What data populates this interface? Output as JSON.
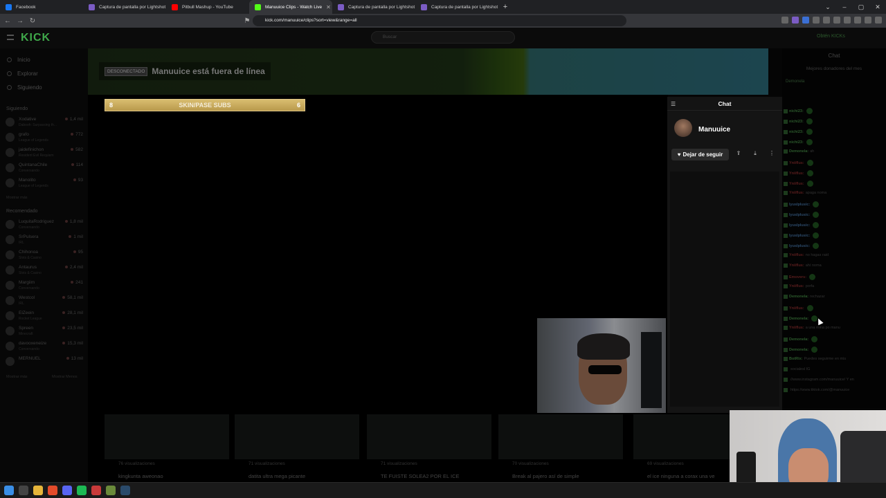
{
  "browser": {
    "tabs": [
      {
        "label": "Facebook",
        "color": "#1877f2"
      },
      {
        "label": "Captura de pantalla por Lightshot",
        "color": "#7b5cc4"
      },
      {
        "label": "Pitbull Mashup - YouTube",
        "color": "#ff0000"
      },
      {
        "label": "Manuuice Clips - Watch Live",
        "color": "#53fc18",
        "active": true
      },
      {
        "label": "Captura de pantalla por Lightshot",
        "color": "#7b5cc4"
      },
      {
        "label": "Captura de pantalla por Lightshot",
        "color": "#7b5cc4"
      }
    ],
    "url": "kick.com/manuuice/clips?sort=view&range=all"
  },
  "kick": {
    "logo": "KICK",
    "search_placeholder": "Buscar",
    "get_kicks": "Obtén KICKs"
  },
  "sidebar": {
    "nav": [
      {
        "label": "Inicio",
        "icon": "home-icon"
      },
      {
        "label": "Explorar",
        "icon": "compass-icon"
      },
      {
        "label": "Siguiendo",
        "icon": "heart-icon"
      }
    ],
    "following_title": "Siguiendo",
    "following": [
      {
        "name": "Xodative",
        "category": "Dabooh: Surpassing th...",
        "count": "1,4 mil"
      },
      {
        "name": "grafo",
        "category": "League of Legends",
        "count": "772"
      },
      {
        "name": "jaidefinichon",
        "category": "Resident Evil Requiem",
        "count": "582"
      },
      {
        "name": "QuintanaChile",
        "category": "Conversando",
        "count": "114"
      },
      {
        "name": "Manolito",
        "category": "League of Legends",
        "count": "93"
      }
    ],
    "following_more": "Mostrar más",
    "recommended_title": "Recomendado",
    "recommended": [
      {
        "name": "LuquitaRodriguez",
        "category": "Conversando",
        "count": "1,8 mil"
      },
      {
        "name": "SrPulsera",
        "category": "IRL",
        "count": "1 mil"
      },
      {
        "name": "Chihonoa",
        "category": "Slots & Casino",
        "count": "95"
      },
      {
        "name": "Antaurus",
        "category": "Slots & Casino",
        "count": "2,4 mil"
      },
      {
        "name": "Margiim",
        "category": "Conversando",
        "count": "241"
      },
      {
        "name": "Westcol",
        "category": "IRL",
        "count": "58,1 mil"
      },
      {
        "name": "ElZeein",
        "category": "Rocket League",
        "count": "28,1 mil"
      },
      {
        "name": "Spreen",
        "category": "Minecraft",
        "count": "23,5 mil"
      },
      {
        "name": "davooxeneize",
        "category": "Conversando",
        "count": "15,3 mil"
      },
      {
        "name": "MERNUEL",
        "category": "",
        "count": "13 mil"
      }
    ],
    "recommended_more": "Mostrar más",
    "recommended_less": "Mostrar Menos"
  },
  "banner": {
    "offline_badge": "DESCONECTADO",
    "offline_text": "Manuuice está fuera de línea"
  },
  "goal": {
    "left": "8",
    "label": "SKIN/PASE SUBS",
    "right": "6"
  },
  "chat_popup": {
    "title": "Chat",
    "streamer": "Manuuice",
    "follow_label": "Dejar de seguir"
  },
  "right_chat": {
    "title": "Chat",
    "top_donors": "Mejores donadores del mes",
    "donor": "Demonela",
    "lines": [
      {
        "user": "nichi23:",
        "msg": "",
        "color": "#2c5a2c"
      },
      {
        "user": "nichi23:",
        "msg": "",
        "color": "#2c5a2c"
      },
      {
        "user": "nichi23:",
        "msg": "",
        "color": "#2c5a2c"
      },
      {
        "user": "nichi23:",
        "msg": "",
        "color": "#2c5a2c"
      },
      {
        "user": "Demonela:",
        "msg": "ah",
        "color": "#2c5a2c"
      },
      {
        "user": "Yniiflus:",
        "msg": "",
        "color": "#5a1d1d"
      },
      {
        "user": "Yniiflus:",
        "msg": "",
        "color": "#5a1d1d"
      },
      {
        "user": "Yniiflus:",
        "msg": "",
        "color": "#5a1d1d"
      },
      {
        "user": "Yniiflus:",
        "msg": "apaga noma",
        "color": "#5a1d1d"
      },
      {
        "user": "lyuslplusic:",
        "msg": "",
        "color": "#2c4a6a"
      },
      {
        "user": "lyuslplusic:",
        "msg": "",
        "color": "#2c4a6a"
      },
      {
        "user": "lyuslplusic:",
        "msg": "",
        "color": "#2c4a6a"
      },
      {
        "user": "lyuslplusic:",
        "msg": "",
        "color": "#2c4a6a"
      },
      {
        "user": "lyuslplusic:",
        "msg": "",
        "color": "#2c4a6a"
      },
      {
        "user": "Yniiflus:",
        "msg": "no hagas raid",
        "color": "#5a1d1d"
      },
      {
        "user": "Yniiflus:",
        "msg": "ahí noma",
        "color": "#5a1d1d"
      },
      {
        "user": "Emovers:",
        "msg": "",
        "color": "#5a1d1d"
      },
      {
        "user": "Yniiflus:",
        "msg": "porfa",
        "color": "#5a1d1d"
      },
      {
        "user": "Demonela:",
        "msg": "rechazar",
        "color": "#2c5a2c"
      },
      {
        "user": "Yniiflus:",
        "msg": "",
        "color": "#5a1d1d"
      },
      {
        "user": "Demonela:",
        "msg": "",
        "color": "#2c5a2c"
      },
      {
        "user": "Yniiflus:",
        "msg": "a una mina po manu",
        "color": "#5a1d1d"
      },
      {
        "user": "Demonela:",
        "msg": "",
        "color": "#2c5a2c"
      },
      {
        "user": "Demonela:",
        "msg": "",
        "color": "#2c5a2c"
      },
      {
        "user": "BotRix:",
        "msg": "Puedes seguirme en mis",
        "color": "#2c5a2c"
      },
      {
        "user": "",
        "msg": "socialesl IG",
        "color": "#333"
      },
      {
        "user": "",
        "msg": "//www.instagram.com/manuuice/ Y en",
        "color": "#1d2c5a"
      },
      {
        "user": "",
        "msg": "https://www.tiktok.com/@manuuice",
        "color": "#1d2c5a"
      }
    ]
  },
  "clips": [
    {
      "views": "76 visualizaciones",
      "title": "kingkunta aweonao"
    },
    {
      "views": "71 visualizaciones",
      "title": "datita ultra mega picante"
    },
    {
      "views": "71 visualizaciones",
      "title": "TE FUISTE SOLEA2 POR EL ICE"
    },
    {
      "views": "70 visualizaciones",
      "title": "Break al pajero así de simple"
    },
    {
      "views": "69 visualizaciones",
      "title": "el ice ninguna a corax una ve"
    }
  ]
}
